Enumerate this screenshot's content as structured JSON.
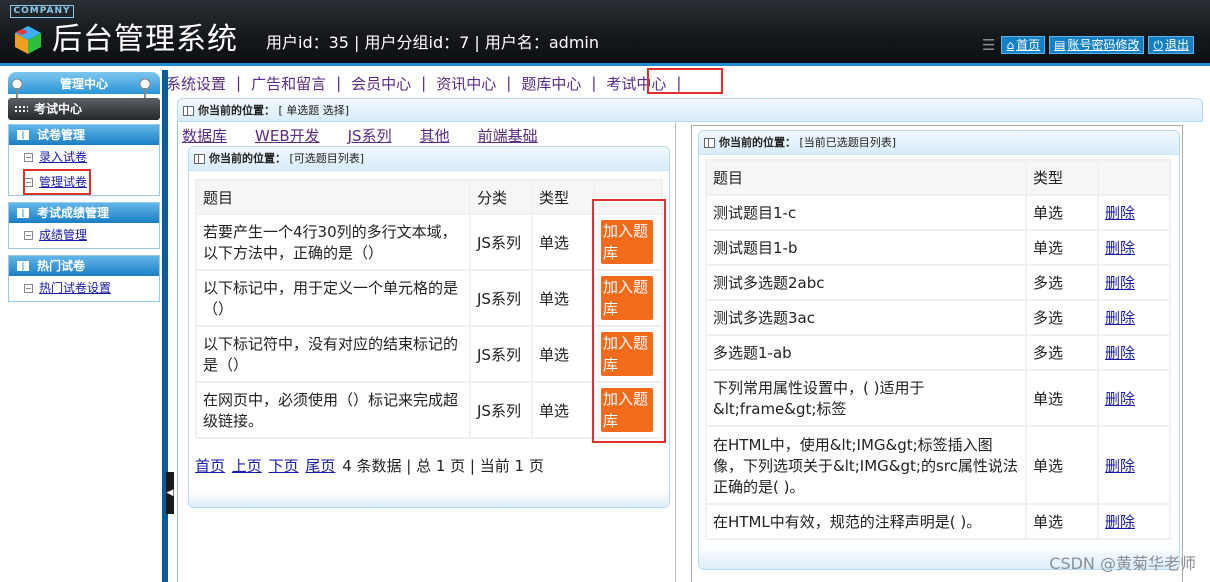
{
  "header": {
    "company": "COMPANY",
    "title": "后台管理系统",
    "user_info": "用户id：35 | 用户分组id：7 | 用户名：admin",
    "tools": [
      {
        "icon": "home-icon",
        "label": "首页"
      },
      {
        "icon": "document-icon",
        "label": "账号密码修改"
      },
      {
        "icon": "power-icon",
        "label": "退出"
      }
    ]
  },
  "topnav": [
    "系统设置",
    "广告和留言",
    "会员中心",
    "资讯中心",
    "题库中心",
    "考试中心"
  ],
  "sidebar": {
    "head": "管理中心",
    "current": "考试中心",
    "groups": [
      {
        "title": "试卷管理",
        "items": [
          "录入试卷",
          "管理试卷"
        ]
      },
      {
        "title": "考试成绩管理",
        "items": [
          "成绩管理"
        ]
      },
      {
        "title": "热门试卷",
        "items": [
          "热门试卷设置"
        ]
      }
    ]
  },
  "main": {
    "position_label": "你当前的位置：",
    "position_value": "[ 单选题 选择]",
    "categories": [
      "数据库",
      "WEB开发",
      "JS系列",
      "其他",
      "前端基础"
    ],
    "left_panel": {
      "position_value": "[可选题目列表]",
      "headers": [
        "题目",
        "分类",
        "类型",
        ""
      ],
      "add_label": "加入题库",
      "rows": [
        {
          "title": "若要产生一个4行30列的多行文本域，以下方法中，正确的是（）",
          "category": "JS系列",
          "type": "单选"
        },
        {
          "title": "以下标记中，用于定义一个单元格的是（）",
          "category": "JS系列",
          "type": "单选"
        },
        {
          "title": "以下标记符中，没有对应的结束标记的是（）",
          "category": "JS系列",
          "type": "单选"
        },
        {
          "title": "在网页中，必须使用（）标记来完成超级链接。",
          "category": "JS系列",
          "type": "单选"
        }
      ],
      "pager": {
        "first": "首页",
        "prev": "上页",
        "next": "下页",
        "last": "尾页",
        "info": "4 条数据 | 总 1 页 | 当前 1 页"
      }
    },
    "right_panel": {
      "position_value": "[当前已选题目列表]",
      "headers": [
        "题目",
        "类型",
        ""
      ],
      "delete_label": "删除",
      "rows": [
        {
          "title": "测试题目1-c",
          "type": "单选"
        },
        {
          "title": "测试题目1-b",
          "type": "单选"
        },
        {
          "title": "测试多选题2abc",
          "type": "多选"
        },
        {
          "title": "测试多选题3ac",
          "type": "多选"
        },
        {
          "title": "多选题1-ab",
          "type": "多选"
        },
        {
          "title": "下列常用属性设置中，( )适用于&lt;frame&gt;标签",
          "type": "单选"
        },
        {
          "title": "在HTML中，使用&lt;IMG&gt;标签插入图像，下列选项关于&lt;IMG&gt;的src属性说法正确的是( )。",
          "type": "单选"
        },
        {
          "title": "在HTML中有效，规范的注释声明是( )。",
          "type": "单选"
        }
      ]
    }
  },
  "watermark": "CSDN @黄菊华老师",
  "colors": {
    "accent": "#1f8ed0",
    "orange": "#f26b1d",
    "highlight": "#e03030",
    "nav": "#5a2d82"
  }
}
